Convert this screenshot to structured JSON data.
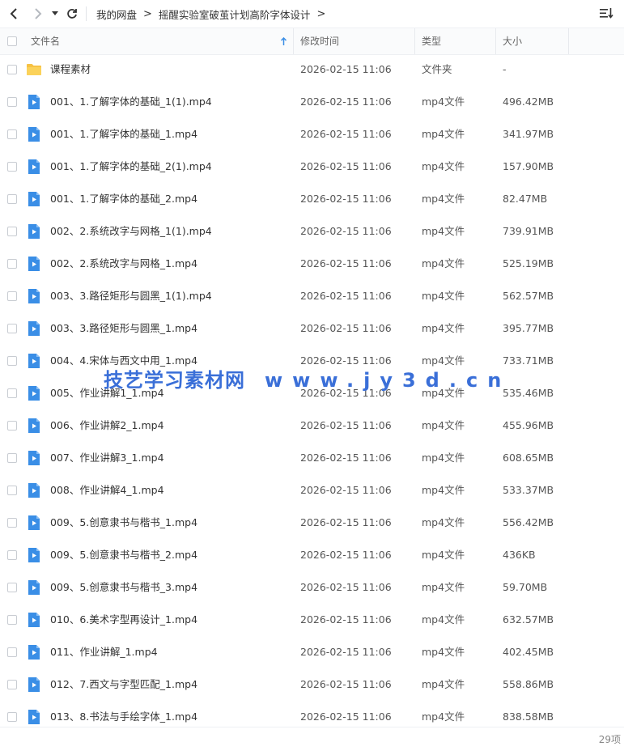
{
  "breadcrumb": {
    "root": "我的网盘",
    "current": "摇醒实验室破茧计划高阶字体设计"
  },
  "columns": {
    "name": "文件名",
    "modified": "修改时间",
    "type": "类型",
    "size": "大小"
  },
  "colors": {
    "accent": "#3a8ee6",
    "folder": "#f7c244",
    "video": "#3a8ee6"
  },
  "rows": [
    {
      "name": "课程素材",
      "modified": "2026-02-15 11:06",
      "type": "文件夹",
      "size": "-",
      "icon": "folder-icon"
    },
    {
      "name": "001、1.了解字体的基础_1(1).mp4",
      "modified": "2026-02-15 11:06",
      "type": "mp4文件",
      "size": "496.42MB",
      "icon": "video-file-icon"
    },
    {
      "name": "001、1.了解字体的基础_1.mp4",
      "modified": "2026-02-15 11:06",
      "type": "mp4文件",
      "size": "341.97MB",
      "icon": "video-file-icon"
    },
    {
      "name": "001、1.了解字体的基础_2(1).mp4",
      "modified": "2026-02-15 11:06",
      "type": "mp4文件",
      "size": "157.90MB",
      "icon": "video-file-icon"
    },
    {
      "name": "001、1.了解字体的基础_2.mp4",
      "modified": "2026-02-15 11:06",
      "type": "mp4文件",
      "size": "82.47MB",
      "icon": "video-file-icon"
    },
    {
      "name": "002、2.系统改字与网格_1(1).mp4",
      "modified": "2026-02-15 11:06",
      "type": "mp4文件",
      "size": "739.91MB",
      "icon": "video-file-icon"
    },
    {
      "name": "002、2.系统改字与网格_1.mp4",
      "modified": "2026-02-15 11:06",
      "type": "mp4文件",
      "size": "525.19MB",
      "icon": "video-file-icon"
    },
    {
      "name": "003、3.路径矩形与圆黑_1(1).mp4",
      "modified": "2026-02-15 11:06",
      "type": "mp4文件",
      "size": "562.57MB",
      "icon": "video-file-icon"
    },
    {
      "name": "003、3.路径矩形与圆黑_1.mp4",
      "modified": "2026-02-15 11:06",
      "type": "mp4文件",
      "size": "395.77MB",
      "icon": "video-file-icon"
    },
    {
      "name": "004、4.宋体与西文中用_1.mp4",
      "modified": "2026-02-15 11:06",
      "type": "mp4文件",
      "size": "733.71MB",
      "icon": "video-file-icon"
    },
    {
      "name": "005、作业讲解1_1.mp4",
      "modified": "2026-02-15 11:06",
      "type": "mp4文件",
      "size": "535.46MB",
      "icon": "video-file-icon"
    },
    {
      "name": "006、作业讲解2_1.mp4",
      "modified": "2026-02-15 11:06",
      "type": "mp4文件",
      "size": "455.96MB",
      "icon": "video-file-icon"
    },
    {
      "name": "007、作业讲解3_1.mp4",
      "modified": "2026-02-15 11:06",
      "type": "mp4文件",
      "size": "608.65MB",
      "icon": "video-file-icon"
    },
    {
      "name": "008、作业讲解4_1.mp4",
      "modified": "2026-02-15 11:06",
      "type": "mp4文件",
      "size": "533.37MB",
      "icon": "video-file-icon"
    },
    {
      "name": "009、5.创意隶书与楷书_1.mp4",
      "modified": "2026-02-15 11:06",
      "type": "mp4文件",
      "size": "556.42MB",
      "icon": "video-file-icon"
    },
    {
      "name": "009、5.创意隶书与楷书_2.mp4",
      "modified": "2026-02-15 11:06",
      "type": "mp4文件",
      "size": "436KB",
      "icon": "video-file-icon"
    },
    {
      "name": "009、5.创意隶书与楷书_3.mp4",
      "modified": "2026-02-15 11:06",
      "type": "mp4文件",
      "size": "59.70MB",
      "icon": "video-file-icon"
    },
    {
      "name": "010、6.美术字型再设计_1.mp4",
      "modified": "2026-02-15 11:06",
      "type": "mp4文件",
      "size": "632.57MB",
      "icon": "video-file-icon"
    },
    {
      "name": "011、作业讲解_1.mp4",
      "modified": "2026-02-15 11:06",
      "type": "mp4文件",
      "size": "402.45MB",
      "icon": "video-file-icon"
    },
    {
      "name": "012、7.西文与字型匹配_1.mp4",
      "modified": "2026-02-15 11:06",
      "type": "mp4文件",
      "size": "558.86MB",
      "icon": "video-file-icon"
    },
    {
      "name": "013、8.书法与手绘字体_1.mp4",
      "modified": "2026-02-15 11:06",
      "type": "mp4文件",
      "size": "838.58MB",
      "icon": "video-file-icon"
    }
  ],
  "watermark": {
    "name": "技艺学习素材网",
    "url": "www.jy3d.cn"
  },
  "footer": {
    "count": "29项"
  }
}
